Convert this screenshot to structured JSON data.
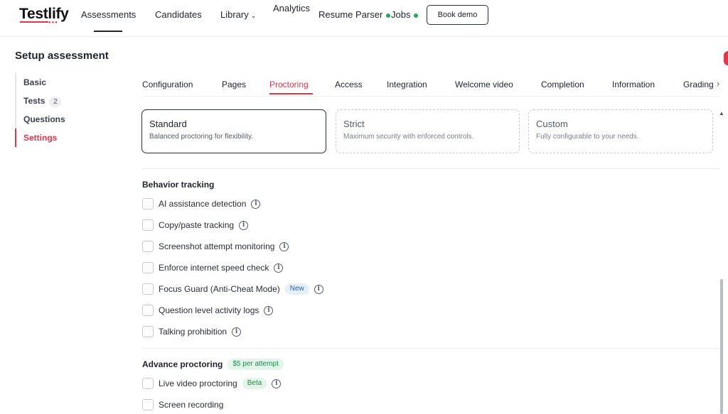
{
  "app": {
    "logo_text": "Testlify",
    "brand_color": "#e0374a"
  },
  "nav": {
    "assessments": "Assessments",
    "candidates": "Candidates",
    "library": "Library",
    "analytics": "Analytics",
    "resume_parser": "Resume Parser",
    "jobs": "Jobs",
    "book_demo": "Book demo"
  },
  "page": {
    "title": "Setup assessment"
  },
  "sidebar": {
    "items": [
      {
        "label": "Basic"
      },
      {
        "label": "Tests",
        "count": "2"
      },
      {
        "label": "Questions"
      },
      {
        "label": "Settings",
        "active": true
      }
    ]
  },
  "tabs": [
    {
      "label": "Configuration"
    },
    {
      "label": "Pages"
    },
    {
      "label": "Proctoring",
      "active": true
    },
    {
      "label": "Access"
    },
    {
      "label": "Integration"
    },
    {
      "label": "Welcome video"
    },
    {
      "label": "Completion"
    },
    {
      "label": "Information"
    },
    {
      "label": "Grading"
    }
  ],
  "modes": [
    {
      "title": "Standard",
      "desc": "Balanced proctoring for flexibility.",
      "selected": true
    },
    {
      "title": "Strict",
      "desc": "Maximum security with enforced controls.",
      "selected": false
    },
    {
      "title": "Custom",
      "desc": "Fully configurable to your needs.",
      "selected": false
    }
  ],
  "behavior": {
    "title": "Behavior tracking",
    "options": [
      {
        "label": "AI assistance detection"
      },
      {
        "label": "Copy/paste tracking"
      },
      {
        "label": "Screenshot attempt monitoring"
      },
      {
        "label": "Enforce internet speed check"
      },
      {
        "label": "Focus Guard (Anti-Cheat Mode)",
        "badge": "New"
      },
      {
        "label": "Question level activity logs"
      },
      {
        "label": "Talking prohibition"
      }
    ]
  },
  "advance": {
    "title": "Advance proctoring",
    "price_badge": "$5 per attempt",
    "options": [
      {
        "label": "Live video proctoring",
        "badge": "Beta"
      },
      {
        "label": "Screen recording"
      }
    ]
  },
  "icons": {
    "info": "info-icon",
    "chevron_down": "chevron-down-icon",
    "chevron_right": "chevron-right-icon",
    "scroll_up": "scroll-up-icon"
  }
}
